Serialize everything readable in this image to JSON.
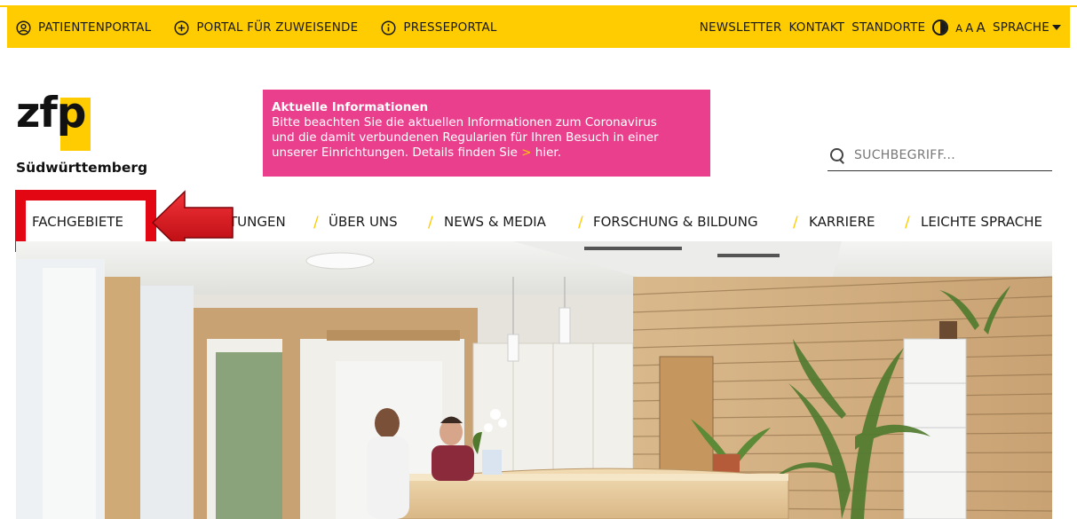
{
  "topbar": {
    "links": [
      {
        "label": "PATIENTENPORTAL",
        "icon": "user-circle-icon"
      },
      {
        "label": "PORTAL FÜR ZUWEISENDE",
        "icon": "plus-circle-icon"
      },
      {
        "label": "PRESSEPORTAL",
        "icon": "info-circle-icon"
      }
    ],
    "newsletter": "NEWSLETTER",
    "kontakt": "KONTAKT",
    "standorte": "STANDORTE",
    "fontsize_a1": "A",
    "fontsize_a2": "A",
    "fontsize_a3": "A",
    "sprache": "SPRACHE"
  },
  "logo": {
    "letters": "zfp",
    "subtitle": "Südwürttemberg"
  },
  "infobox": {
    "title": "Aktuelle Informationen",
    "line1": "Bitte beachten Sie die aktuellen Informationen zum Coronavirus",
    "line2": "und die damit verbundenen Regularien für Ihren Besuch in einer",
    "line3": "unserer Einrichtungen. Details finden Sie",
    "chevron": ">",
    "link": "hier."
  },
  "search": {
    "placeholder": "SUCHBEGRIFF..."
  },
  "nav": {
    "items": [
      "FACHGEBIETE",
      "TUNGEN",
      "ÜBER UNS",
      "NEWS & MEDIA",
      "FORSCHUNG & BILDUNG",
      "KARRIERE",
      "LEICHTE SPRACHE"
    ],
    "separator": "/"
  },
  "colors": {
    "brand_yellow": "#fecc00",
    "info_pink": "#ea3f8c",
    "highlight_red": "#e30613"
  }
}
